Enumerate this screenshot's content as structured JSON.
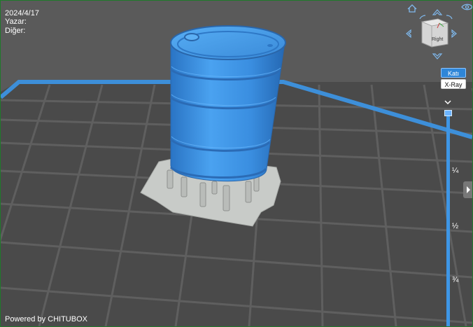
{
  "info": {
    "date": "2024/4/17",
    "author": "Yazar:",
    "other": "Diğer:"
  },
  "footer": {
    "powered_by": "Powered by CHITUBOX"
  },
  "view_modes": {
    "solid": "Katı",
    "xray": "X-Ray"
  },
  "view_cube": {
    "face_label": "Right"
  },
  "layer_slider": {
    "marks": [
      "¼",
      "½",
      "¾"
    ],
    "position": 0.0
  },
  "colors": {
    "model": "#3c8ee0",
    "build_plate_border": "#3d8fd9",
    "support": "#c4c7c4",
    "background": "#5a5a5a",
    "window_border": "#1f7a2a"
  },
  "icons": [
    "home-icon",
    "eye-icon",
    "arrow-up-icon",
    "arrow-down-icon",
    "arrow-left-icon",
    "arrow-right-icon",
    "rotate-left-icon",
    "rotate-right-icon",
    "chevron-down-icon",
    "chevron-right-icon"
  ]
}
